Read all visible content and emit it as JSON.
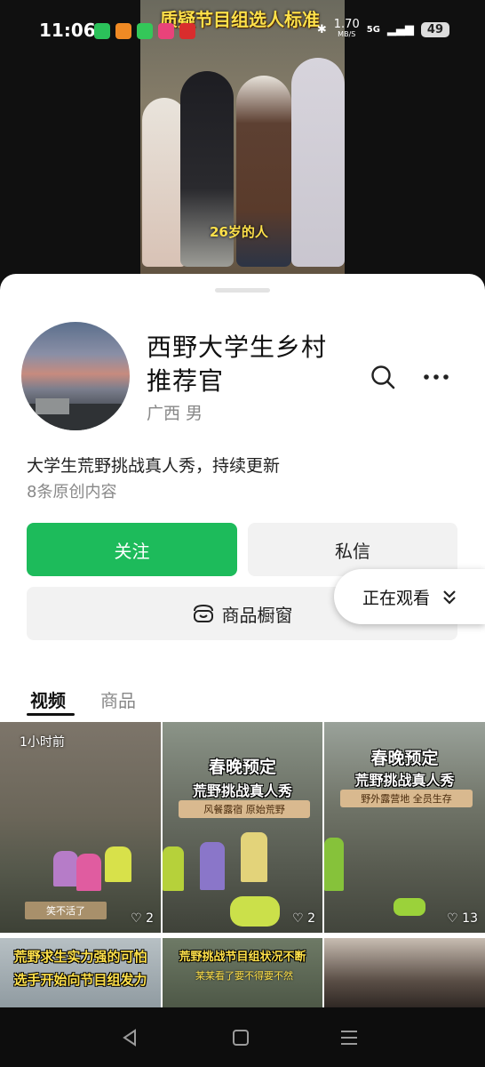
{
  "status_bar": {
    "time": "11:06",
    "network_speed": "1.70",
    "network_unit": "MB/S",
    "signal": "5G",
    "battery": "49"
  },
  "video": {
    "caption": "质疑节目组选人标准",
    "subtitle": "26岁的人"
  },
  "profile": {
    "name": "西野大学生乡村推荐官",
    "location": "广西 男",
    "bio": "大学生荒野挑战真人秀，持续更新",
    "stats": "8条原创内容"
  },
  "actions": {
    "follow": "关注",
    "message": "私信",
    "shop": "商品橱窗"
  },
  "tabs": [
    "视频",
    "商品"
  ],
  "grid": [
    {
      "badge": "1小时前",
      "inset_text": "笑不活了",
      "likes": "2"
    },
    {
      "headline": "春晚预定",
      "headline2": "荒野挑战真人秀",
      "tag": "风餐露宿 原始荒野",
      "likes": "2"
    },
    {
      "headline": "春晚预定",
      "headline2": "荒野挑战真人秀",
      "tag": "野外露营地 全员生存",
      "likes": "13"
    },
    {
      "headline": "荒野求生实力强的可怕",
      "headline2": "选手开始向节目组发力"
    },
    {
      "headline": "荒野挑战节目组状况不断",
      "tag": "某某看了要不得要不然"
    }
  ],
  "floating": {
    "watching": "正在观看"
  },
  "colors": {
    "accent_green": "#1dbb5b",
    "caption_yellow": "#ffe14a"
  }
}
